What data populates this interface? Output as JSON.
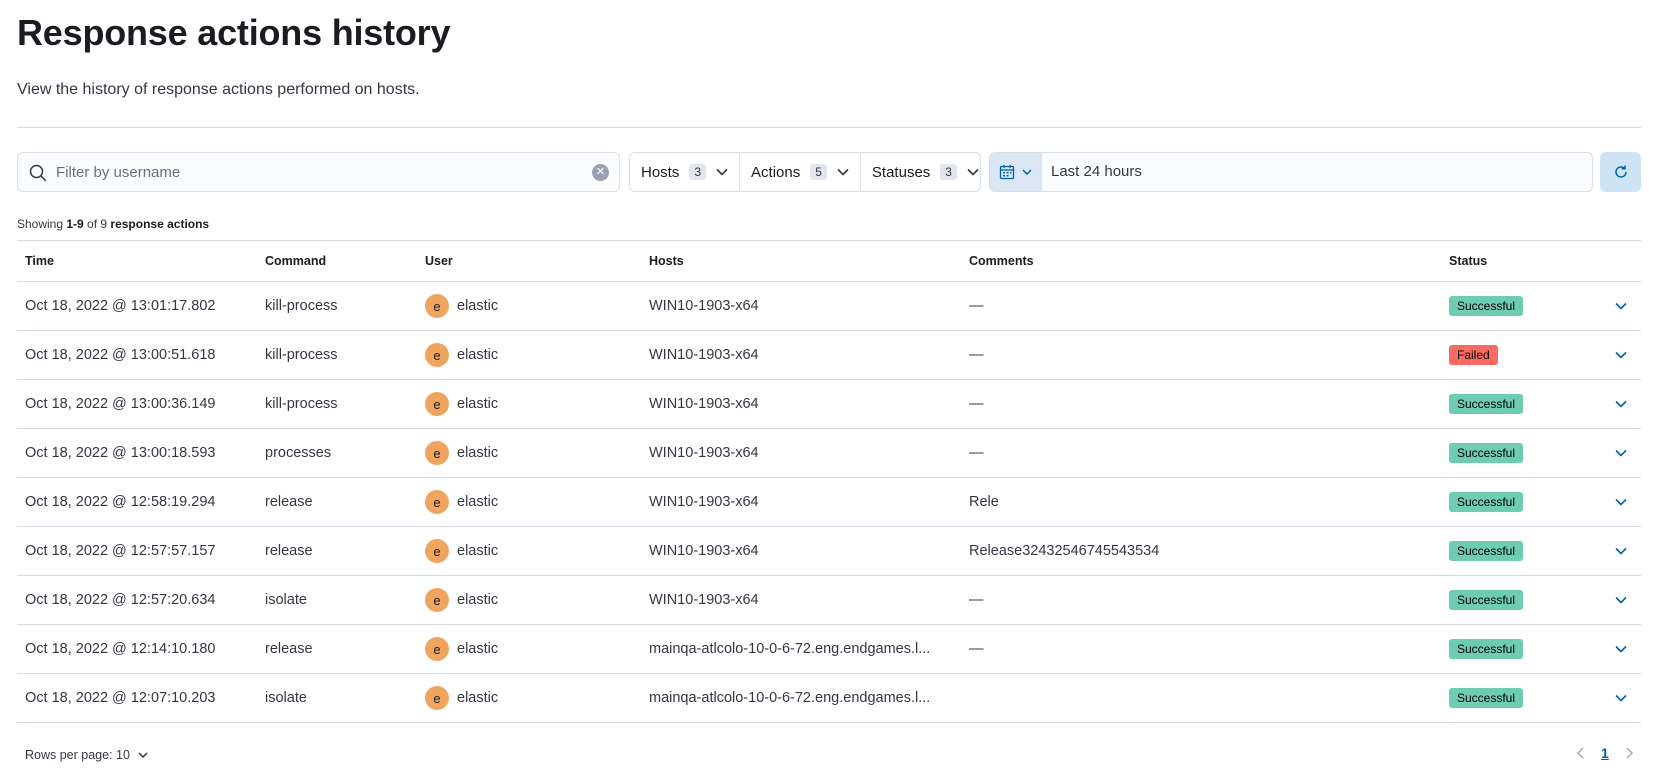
{
  "page": {
    "title": "Response actions history",
    "description": "View the history of response actions performed on hosts."
  },
  "search": {
    "placeholder": "Filter by username",
    "value": ""
  },
  "filters": [
    {
      "label": "Hosts",
      "count": "3"
    },
    {
      "label": "Actions",
      "count": "5"
    },
    {
      "label": "Statuses",
      "count": "3"
    }
  ],
  "date_picker": {
    "range": "Last 24 hours"
  },
  "summary": {
    "prefix": "Showing ",
    "range": "1-9",
    "middle": " of 9 ",
    "suffix": "response actions"
  },
  "table": {
    "headers": {
      "time": "Time",
      "command": "Command",
      "user": "User",
      "hosts": "Hosts",
      "comments": "Comments",
      "status": "Status"
    },
    "rows": [
      {
        "time": "Oct 18, 2022 @ 13:01:17.802",
        "command": "kill-process",
        "avatar": "e",
        "user": "elastic",
        "hosts": "WIN10-1903-x64",
        "comments": "—",
        "status": "Successful"
      },
      {
        "time": "Oct 18, 2022 @ 13:00:51.618",
        "command": "kill-process",
        "avatar": "e",
        "user": "elastic",
        "hosts": "WIN10-1903-x64",
        "comments": "—",
        "status": "Failed"
      },
      {
        "time": "Oct 18, 2022 @ 13:00:36.149",
        "command": "kill-process",
        "avatar": "e",
        "user": "elastic",
        "hosts": "WIN10-1903-x64",
        "comments": "—",
        "status": "Successful"
      },
      {
        "time": "Oct 18, 2022 @ 13:00:18.593",
        "command": "processes",
        "avatar": "e",
        "user": "elastic",
        "hosts": "WIN10-1903-x64",
        "comments": "—",
        "status": "Successful"
      },
      {
        "time": "Oct 18, 2022 @ 12:58:19.294",
        "command": "release",
        "avatar": "e",
        "user": "elastic",
        "hosts": "WIN10-1903-x64",
        "comments": "Rele",
        "status": "Successful"
      },
      {
        "time": "Oct 18, 2022 @ 12:57:57.157",
        "command": "release",
        "avatar": "e",
        "user": "elastic",
        "hosts": "WIN10-1903-x64",
        "comments": "Release32432546745543534",
        "status": "Successful"
      },
      {
        "time": "Oct 18, 2022 @ 12:57:20.634",
        "command": "isolate",
        "avatar": "e",
        "user": "elastic",
        "hosts": "WIN10-1903-x64",
        "comments": "—",
        "status": "Successful"
      },
      {
        "time": "Oct 18, 2022 @ 12:14:10.180",
        "command": "release",
        "avatar": "e",
        "user": "elastic",
        "hosts": "mainqa-atlcolo-10-0-6-72.eng.endgames.l...",
        "comments": "—",
        "status": "Successful"
      },
      {
        "time": "Oct 18, 2022 @ 12:07:10.203",
        "command": "isolate",
        "avatar": "e",
        "user": "elastic",
        "hosts": "mainqa-atlcolo-10-0-6-72.eng.endgames.l...",
        "comments": "",
        "status": "Successful"
      }
    ]
  },
  "status_colors": {
    "Successful": "#6dccb1",
    "Failed": "#f86b63"
  },
  "footer": {
    "rows_per_page": "Rows per page: 10",
    "current_page": "1"
  },
  "icons": {
    "search": "search-icon",
    "clear": "clear-icon",
    "calendar": "calendar-icon",
    "refresh": "refresh-icon",
    "expand": "chevron-down-icon"
  }
}
